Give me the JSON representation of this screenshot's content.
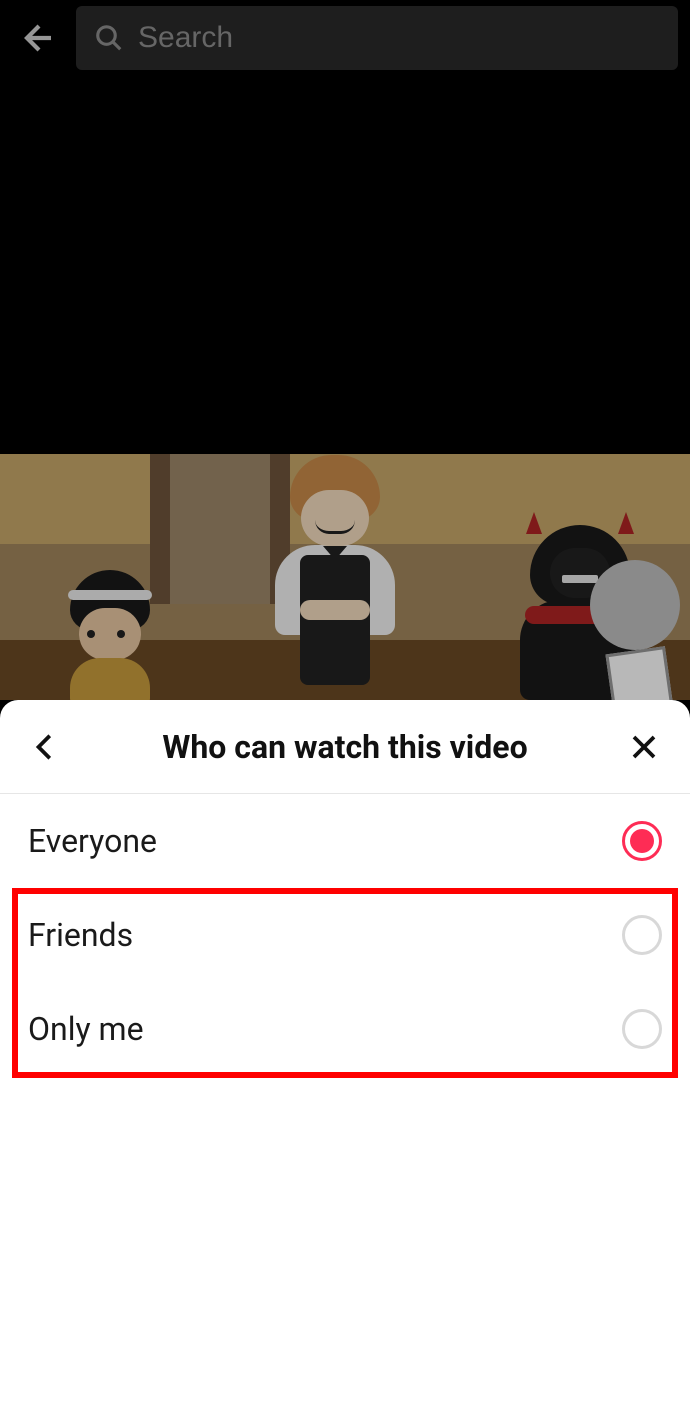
{
  "header": {
    "search_placeholder": "Search"
  },
  "sheet": {
    "title": "Who can watch this video",
    "options": [
      {
        "label": "Everyone",
        "selected": true
      },
      {
        "label": "Friends",
        "selected": false
      },
      {
        "label": "Only me",
        "selected": false
      }
    ]
  },
  "colors": {
    "accent": "#fe2c55",
    "highlight": "#ff0000"
  }
}
